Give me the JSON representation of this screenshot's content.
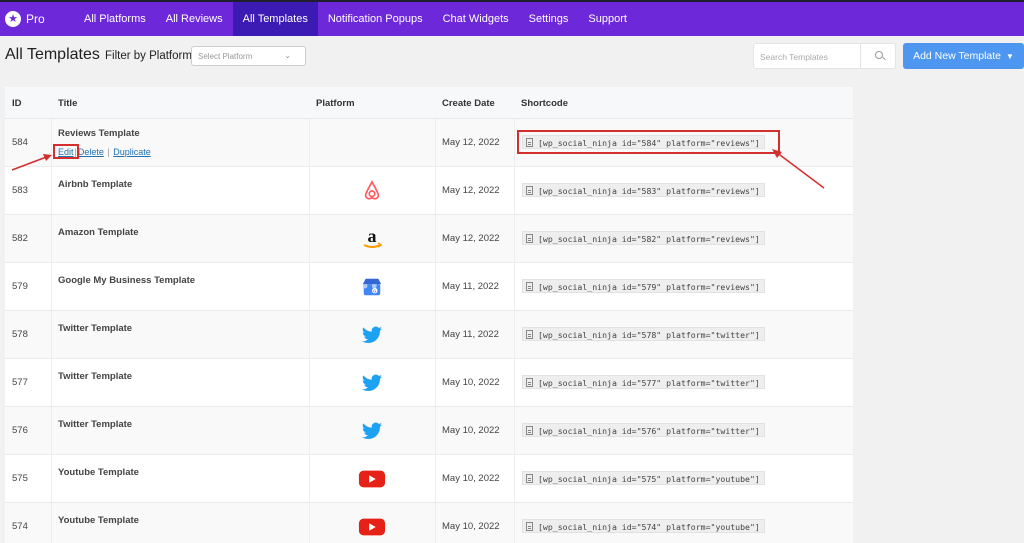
{
  "nav": {
    "logo_text": "Pro",
    "items": [
      {
        "label": "All Platforms"
      },
      {
        "label": "All Reviews"
      },
      {
        "label": "All Templates",
        "active": true
      },
      {
        "label": "Notification Popups"
      },
      {
        "label": "Chat Widgets"
      },
      {
        "label": "Settings"
      },
      {
        "label": "Support"
      }
    ]
  },
  "toolbar": {
    "page_title": "All Templates",
    "filter_label": "Filter by Platform",
    "select_placeholder": "Select Platform",
    "search_placeholder": "Search Templates",
    "add_button_label": "Add New Template"
  },
  "table": {
    "columns": [
      "ID",
      "Title",
      "Platform",
      "Create Date",
      "Shortcode"
    ],
    "row_actions": {
      "edit": "Edit",
      "delete": "Delete",
      "duplicate": "Duplicate"
    },
    "rows": [
      {
        "id": "584",
        "title": "Reviews Template",
        "platform": "",
        "date": "May 12, 2022",
        "shortcode": "[wp_social_ninja id=\"584\" platform=\"reviews\"]"
      },
      {
        "id": "583",
        "title": "Airbnb Template",
        "platform": "airbnb-icon",
        "date": "May 12, 2022",
        "shortcode": "[wp_social_ninja id=\"583\" platform=\"reviews\"]"
      },
      {
        "id": "582",
        "title": "Amazon Template",
        "platform": "amazon-icon",
        "date": "May 12, 2022",
        "shortcode": "[wp_social_ninja id=\"582\" platform=\"reviews\"]"
      },
      {
        "id": "579",
        "title": "Google My Business Template",
        "platform": "google-my-business-icon",
        "date": "May 11, 2022",
        "shortcode": "[wp_social_ninja id=\"579\" platform=\"reviews\"]"
      },
      {
        "id": "578",
        "title": "Twitter Template",
        "platform": "twitter-icon",
        "date": "May 11, 2022",
        "shortcode": "[wp_social_ninja id=\"578\" platform=\"twitter\"]"
      },
      {
        "id": "577",
        "title": "Twitter Template",
        "platform": "twitter-icon",
        "date": "May 10, 2022",
        "shortcode": "[wp_social_ninja id=\"577\" platform=\"twitter\"]"
      },
      {
        "id": "576",
        "title": "Twitter Template",
        "platform": "twitter-icon",
        "date": "May 10, 2022",
        "shortcode": "[wp_social_ninja id=\"576\" platform=\"twitter\"]"
      },
      {
        "id": "575",
        "title": "Youtube Template",
        "platform": "youtube-icon",
        "date": "May 10, 2022",
        "shortcode": "[wp_social_ninja id=\"575\" platform=\"youtube\"]"
      },
      {
        "id": "574",
        "title": "Youtube Template",
        "platform": "youtube-icon",
        "date": "May 10, 2022",
        "shortcode": "[wp_social_ninja id=\"574\" platform=\"youtube\"]"
      }
    ]
  },
  "colors": {
    "nav_bg": "#6d28d9",
    "nav_active": "#3b1bb3",
    "primary_button": "#4d97f0",
    "link": "#2271b1",
    "annotation": "#d32f2f",
    "airbnb": "#ff5a5f",
    "twitter": "#1da1f2",
    "youtube": "#e62117"
  }
}
